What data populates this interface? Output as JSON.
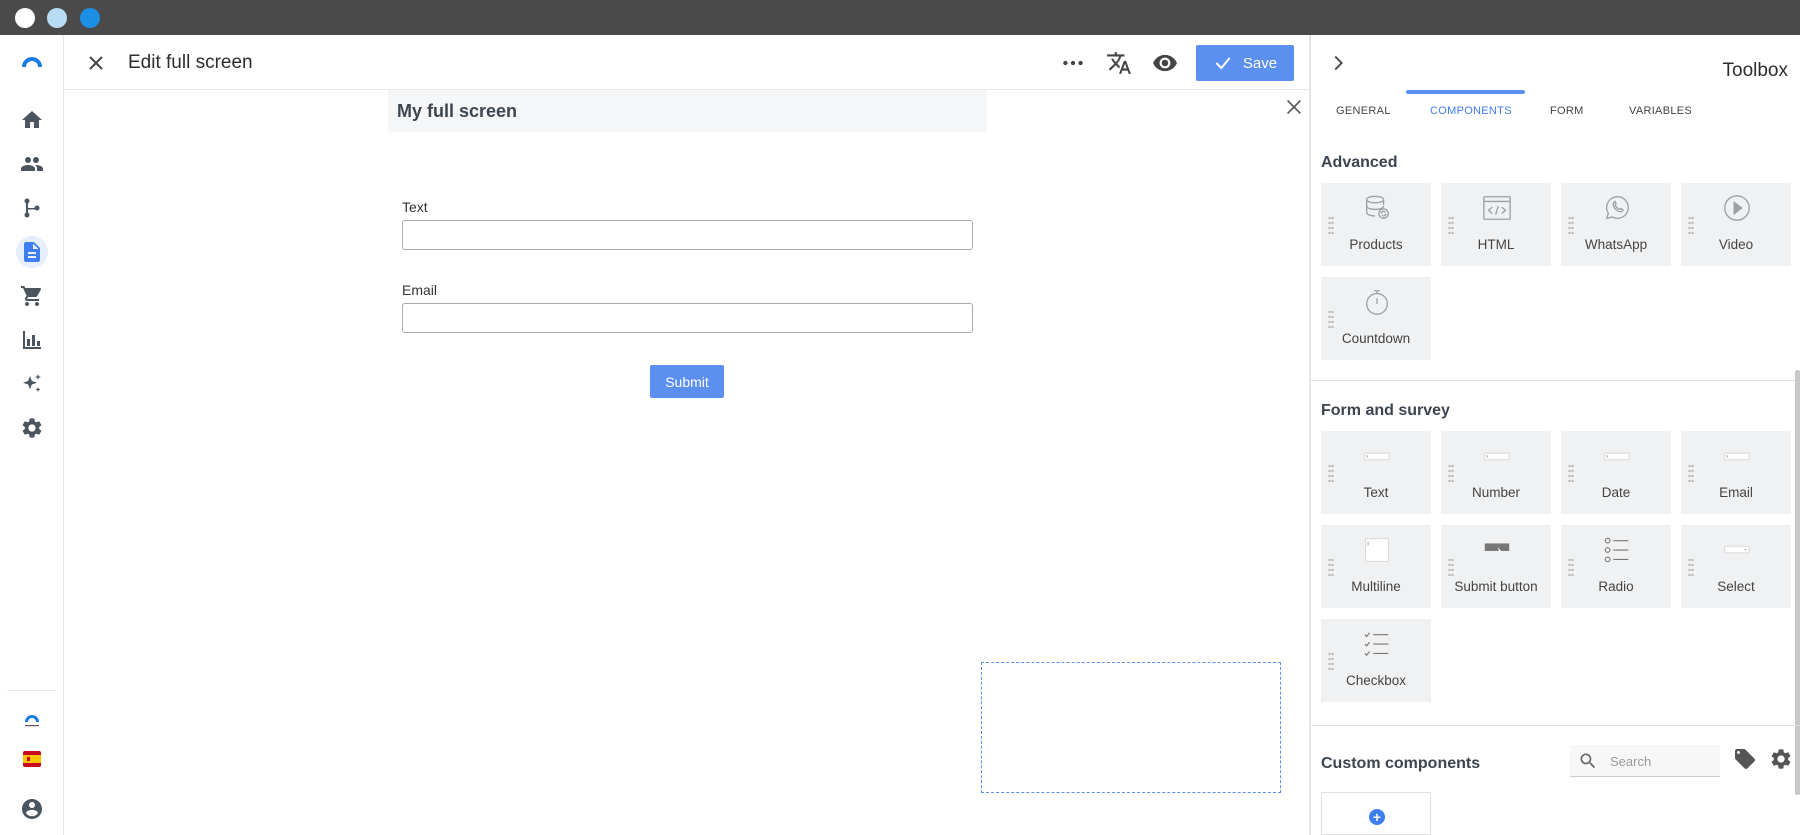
{
  "header": {
    "title": "Edit full screen",
    "save_label": "Save"
  },
  "canvas": {
    "screen_title": "My full screen",
    "fields": [
      {
        "label": "Text",
        "value": ""
      },
      {
        "label": "Email",
        "value": ""
      }
    ],
    "submit_label": "Submit"
  },
  "toolbox": {
    "title": "Toolbox",
    "tabs": [
      "GENERAL",
      "COMPONENTS",
      "FORM",
      "VARIABLES"
    ],
    "active_tab": "COMPONENTS",
    "sections": {
      "advanced": {
        "title": "Advanced",
        "items": [
          "Products",
          "HTML",
          "WhatsApp",
          "Video",
          "Countdown"
        ]
      },
      "form": {
        "title": "Form and survey",
        "items": [
          "Text",
          "Number",
          "Date",
          "Email",
          "Multiline",
          "Submit button",
          "Radio",
          "Select",
          "Checkbox"
        ]
      },
      "custom": {
        "title": "Custom components",
        "search_placeholder": "Search"
      }
    }
  },
  "nav": {
    "items": [
      "home-icon",
      "people-icon",
      "flow-icon",
      "document-icon",
      "cart-icon",
      "bar-chart-icon",
      "sparkles-icon",
      "gear-icon"
    ],
    "active": "document-icon"
  },
  "colors": {
    "accent": "#5b8ff0",
    "titlebar": "#4a4a4a",
    "tile_bg": "#f0f1f2"
  }
}
